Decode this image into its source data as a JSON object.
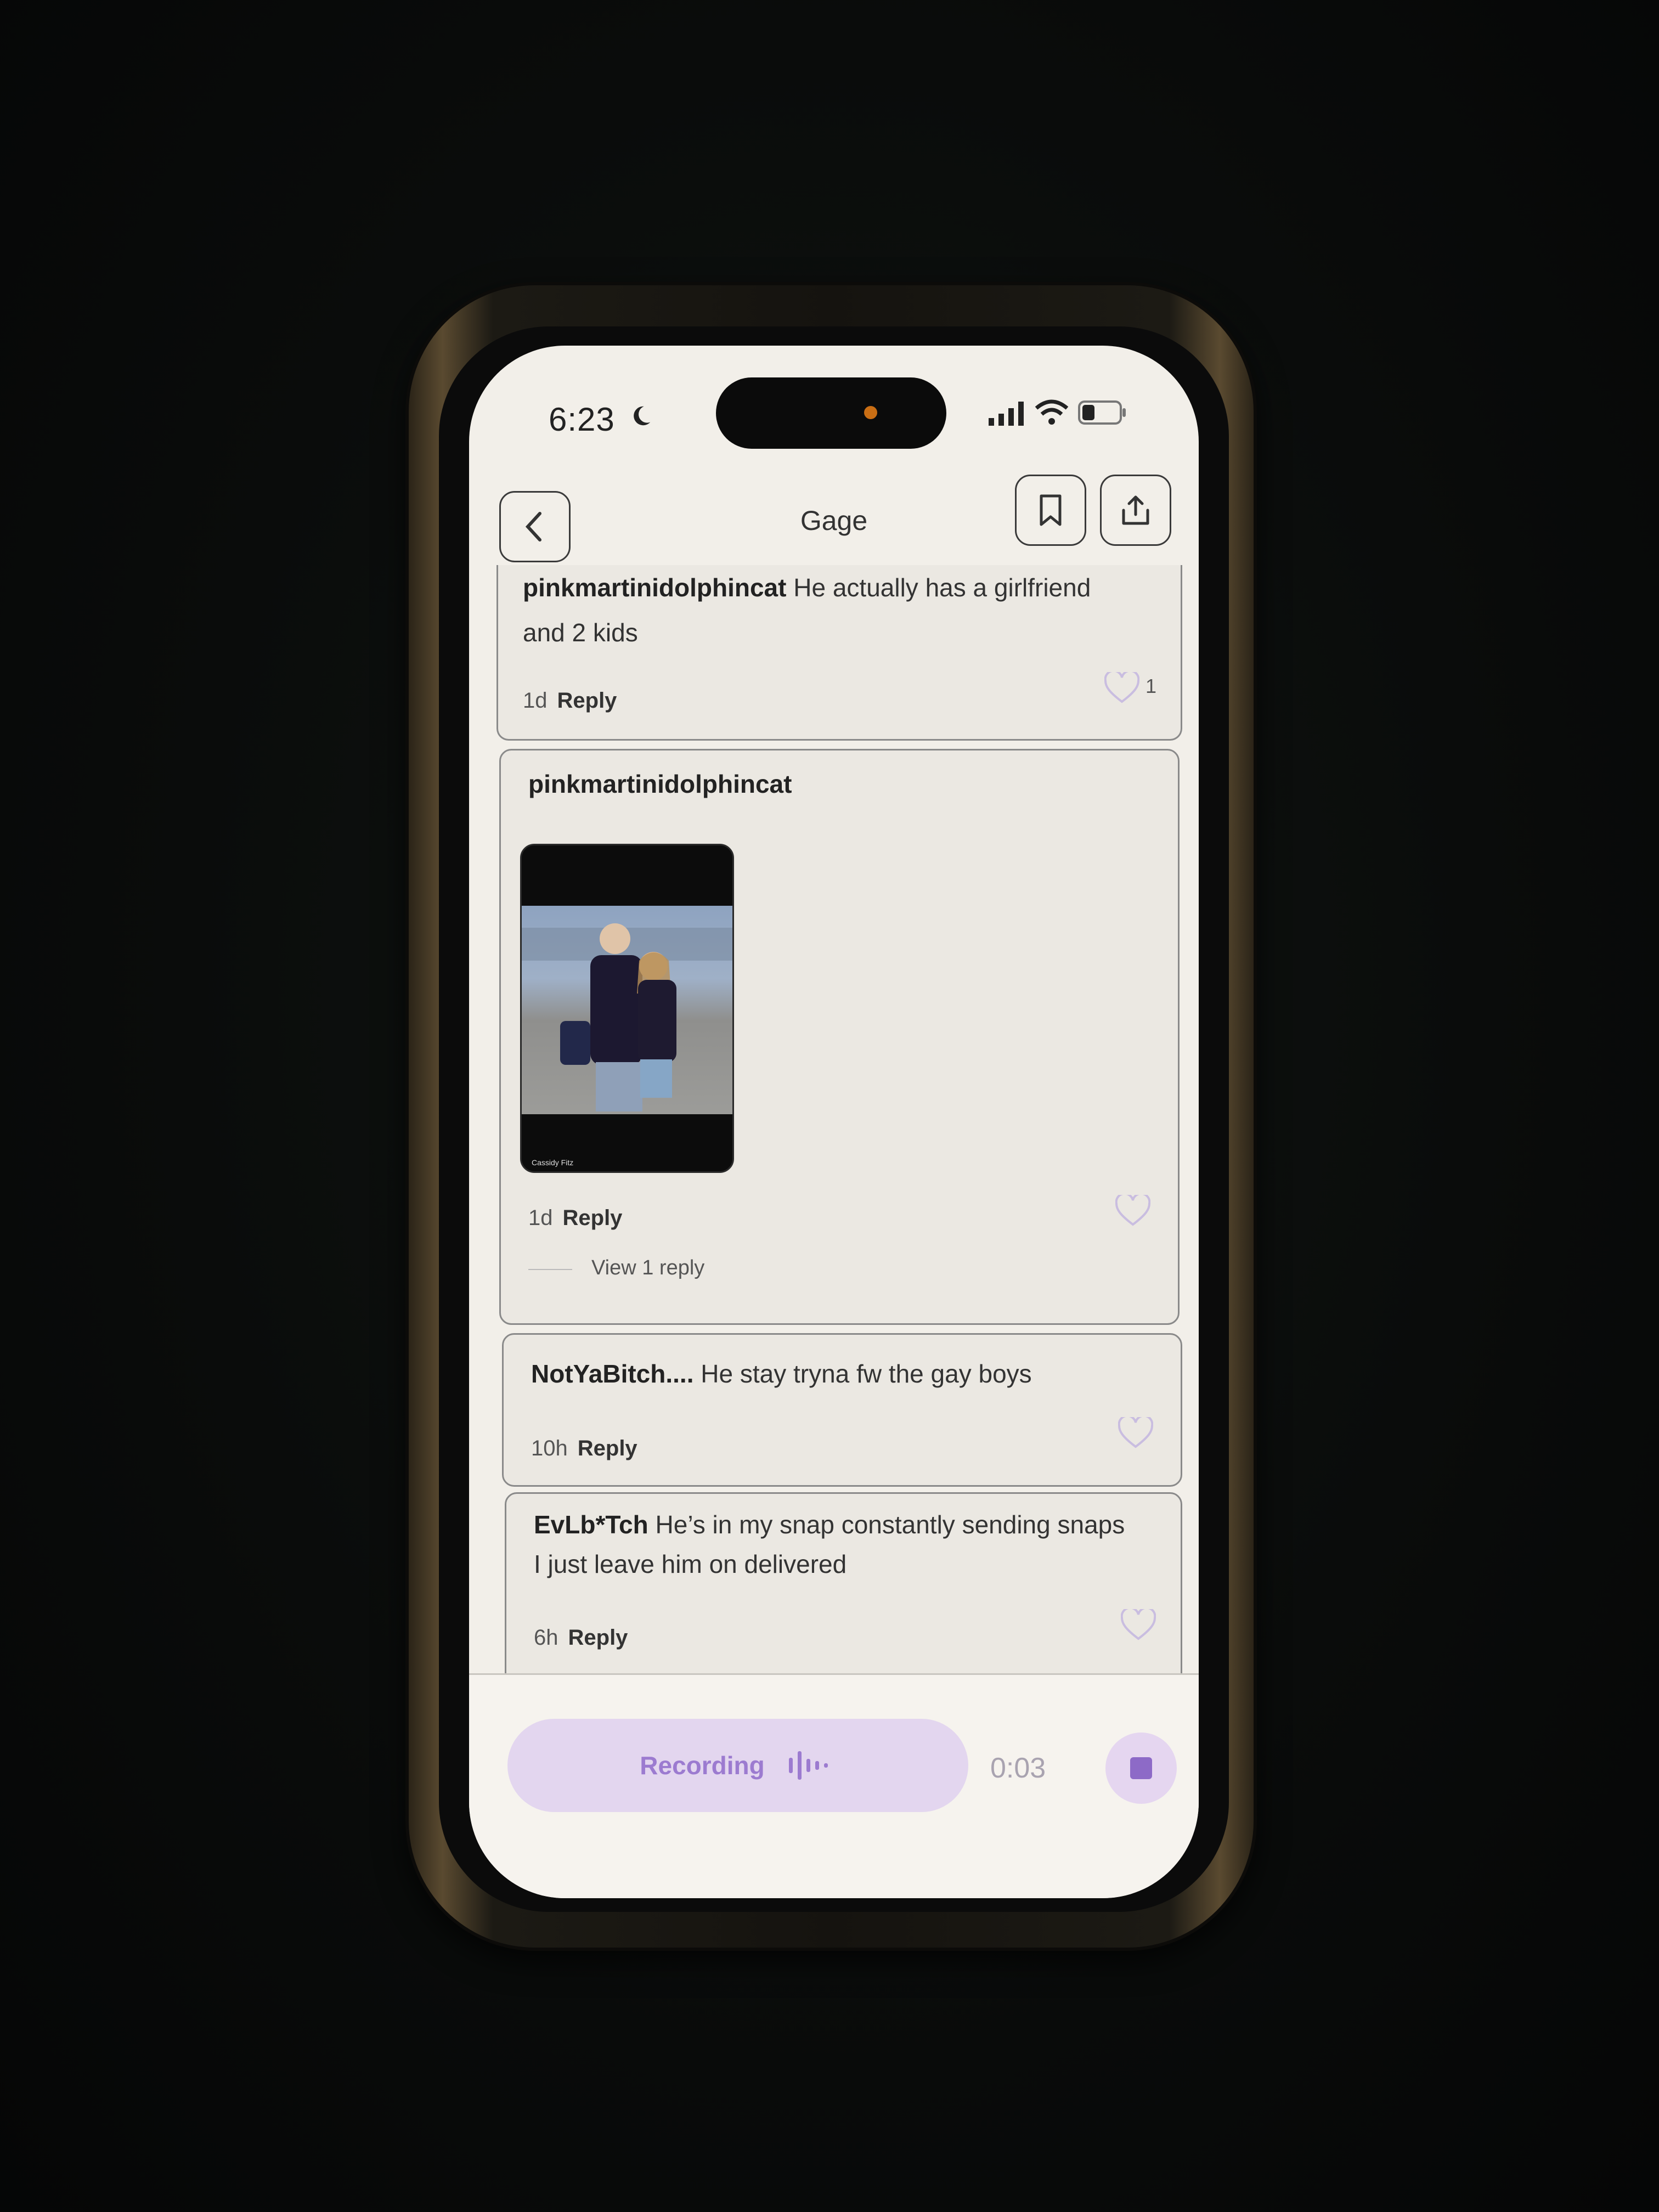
{
  "status_bar": {
    "time": "6:23"
  },
  "header": {
    "title": "Gage"
  },
  "comments": [
    {
      "user": "pinkmartinidolphincat",
      "text": "He actually has a girlfriend and 2 kids",
      "age": "1d",
      "reply_label": "Reply",
      "likes": "1"
    },
    {
      "user": "pinkmartinidolphincat",
      "photo_caption": "Cassidy Fitz",
      "age": "1d",
      "reply_label": "Reply",
      "view_replies": "View 1 reply"
    },
    {
      "user": "NotYaBitch....",
      "text": "He stay tryna fw the gay boys",
      "age": "10h",
      "reply_label": "Reply"
    },
    {
      "user": "EvLb*Tch",
      "text": "He’s in my snap constantly sending snaps I just leave him on delivered",
      "age": "6h",
      "reply_label": "Reply"
    }
  ],
  "composer": {
    "recording_label": "Recording",
    "timer": "0:03"
  },
  "icons": [
    "moon-icon",
    "signal-icon",
    "wifi-icon",
    "battery-icon",
    "back-icon",
    "bookmark-icon",
    "share-icon",
    "heart-icon",
    "waveform-icon",
    "stop-icon"
  ],
  "colors": {
    "accent": "#8d6ac7",
    "recording_bg": "#e3d6ef",
    "screen_bg": "#f2efe9"
  }
}
